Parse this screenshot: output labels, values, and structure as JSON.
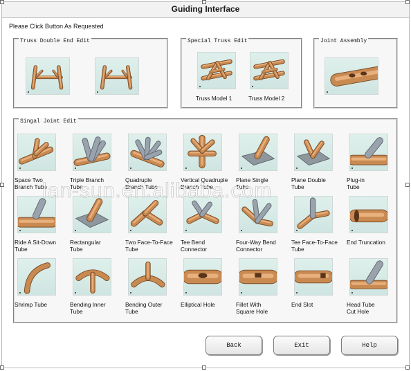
{
  "window": {
    "title": "Guiding Interface"
  },
  "prompt": "Please Click Button As Requested",
  "groups": {
    "truss_double_end": {
      "title": "Truss Double End Edit",
      "items": [
        {
          "label": "",
          "icon": "truss-double-end-icon"
        },
        {
          "label": "",
          "icon": "truss-double-end-icon"
        }
      ]
    },
    "special_truss": {
      "title": "Special Truss Edit",
      "items": [
        {
          "label": "Truss Model 1",
          "icon": "truss-model-icon"
        },
        {
          "label": "Truss Model 2",
          "icon": "truss-model-icon"
        }
      ]
    },
    "joint_assembly": {
      "title": "Joint Assembly",
      "items": [
        {
          "label": "",
          "icon": "joint-assembly-icon"
        }
      ]
    },
    "singal_joint": {
      "title": "Singal Joint Edit",
      "items": [
        {
          "label": "Space Two\nBranch Tube",
          "icon": "space-two-branch-icon"
        },
        {
          "label": "Triple Branch\nTube",
          "icon": "triple-branch-icon"
        },
        {
          "label": "Quadruple\nBranch Tube",
          "icon": "quadruple-branch-icon"
        },
        {
          "label": "Vertical Quadruple\nBranch Tube",
          "icon": "vertical-quadruple-icon"
        },
        {
          "label": "Plane Single\nTube",
          "icon": "plane-single-icon"
        },
        {
          "label": "Plane Double\nTube",
          "icon": "plane-double-icon"
        },
        {
          "label": "Plug-in\nTube",
          "icon": "plug-in-icon"
        },
        {
          "label": "Ride A Sit-Down\nTube",
          "icon": "ride-sit-down-icon"
        },
        {
          "label": "Rectangular\nTube",
          "icon": "rectangular-tube-icon"
        },
        {
          "label": "Two Face-To-Face\nTube",
          "icon": "two-face-icon"
        },
        {
          "label": "Tee Bend\nConnector",
          "icon": "tee-bend-icon"
        },
        {
          "label": "Four-Way Bend\nConnector",
          "icon": "four-way-bend-icon"
        },
        {
          "label": "Tee Face-To-Face\nTube",
          "icon": "tee-face-icon"
        },
        {
          "label": "End Truncation",
          "icon": "end-truncation-icon"
        },
        {
          "label": "Shrimp Tube",
          "icon": "shrimp-tube-icon"
        },
        {
          "label": "Bending Inner\nTube",
          "icon": "bending-inner-icon"
        },
        {
          "label": "Bending Outer\nTube",
          "icon": "bending-outer-icon"
        },
        {
          "label": "Elliptical Hole",
          "icon": "elliptical-hole-icon"
        },
        {
          "label": "Fillet With\nSquare Hole",
          "icon": "fillet-square-hole-icon"
        },
        {
          "label": "End Slot",
          "icon": "end-slot-icon"
        },
        {
          "label": "Head Tube\nCut Hole",
          "icon": "head-tube-cut-icon"
        }
      ]
    }
  },
  "buttons": {
    "back": "Back",
    "exit": "Exit",
    "help": "Help"
  },
  "watermark": "lan-sun.en.alibaba.com",
  "colors": {
    "tube": "#c98a52",
    "tube_light": "#e8b07c",
    "plate": "#9aa3ad",
    "thumb_bg": "#d8ece8"
  }
}
